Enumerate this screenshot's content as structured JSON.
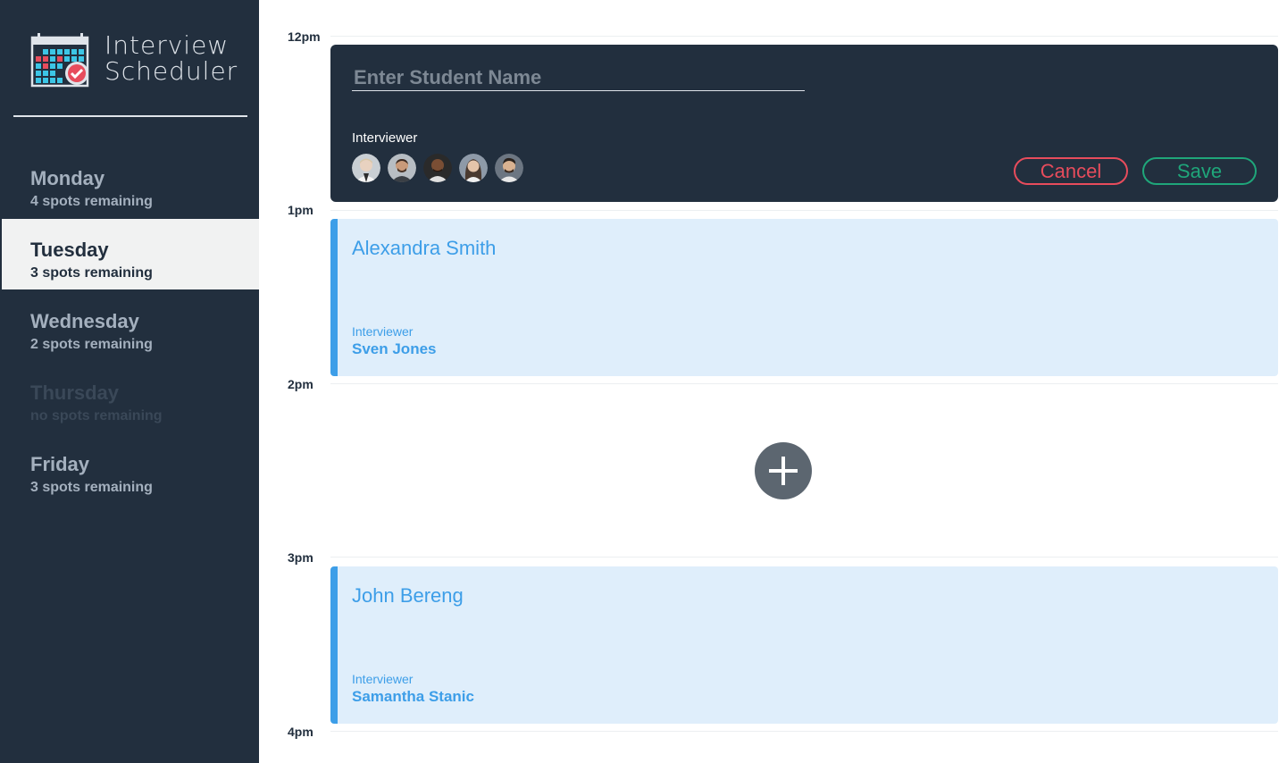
{
  "app": {
    "title_line1": "Interview",
    "title_line2": "Scheduler"
  },
  "days": [
    {
      "name": "Monday",
      "spots": "4 spots remaining"
    },
    {
      "name": "Tuesday",
      "spots": "3 spots remaining"
    },
    {
      "name": "Wednesday",
      "spots": "2 spots remaining"
    },
    {
      "name": "Thursday",
      "spots": "no spots remaining"
    },
    {
      "name": "Friday",
      "spots": "3 spots remaining"
    }
  ],
  "selected_day": "Tuesday",
  "hours": [
    "12pm",
    "1pm",
    "2pm",
    "3pm",
    "4pm"
  ],
  "form": {
    "student_placeholder": "Enter Student Name",
    "student_value": "",
    "interviewer_label": "Interviewer",
    "avatar_count": 5,
    "cancel_label": "Cancel",
    "save_label": "Save"
  },
  "appointments": [
    {
      "student": "Alexandra Smith",
      "interviewer_label": "Interviewer",
      "interviewer": "Sven Jones"
    },
    {
      "student": "John Bereng",
      "interviewer_label": "Interviewer",
      "interviewer": "Samantha Stanic"
    }
  ],
  "icons": {
    "logo": "calendar-check-icon",
    "add": "plus-icon"
  },
  "colors": {
    "sidebar_bg": "#222f3e",
    "accent_blue": "#3d9ee8",
    "cancel_red": "#e74c5c",
    "save_green": "#1fa67a"
  }
}
